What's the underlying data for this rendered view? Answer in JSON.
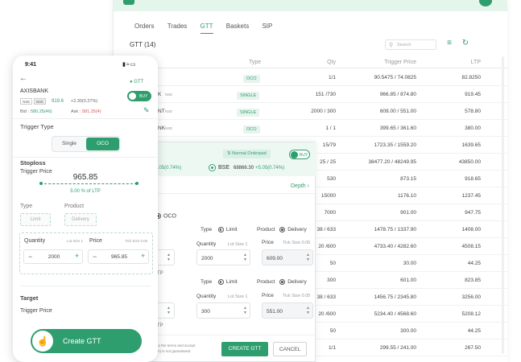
{
  "colors": {
    "accent": "#2f9e6e",
    "positive": "#2f9e6e",
    "negative": "#d9534f"
  },
  "desktop": {
    "tabs": [
      {
        "label": "Orders"
      },
      {
        "label": "Trades"
      },
      {
        "label": "GTT"
      },
      {
        "label": "Baskets"
      },
      {
        "label": "SIP"
      }
    ],
    "gtt_count_label": "GTT (14)",
    "search_placeholder": "Search",
    "columns": {
      "type": "Type",
      "qty": "Qty",
      "trigger_price": "Trigger Price",
      "ltp": "LTP"
    },
    "rows": [
      {
        "name": "",
        "exch": "",
        "type": "OCO",
        "qty": "1/1",
        "trigger": "90.5475 / 74.0825",
        "ltp": "82.8250"
      },
      {
        "name": "K",
        "exch": "NSE",
        "type": "SINGLE",
        "qty": "151 /730",
        "trigger": "966.85 / 874.80",
        "ltp": "919.45"
      },
      {
        "name": "NT",
        "exch": "NSE",
        "type": "SINGLE",
        "qty": "2000 / 300",
        "trigger": "609.00 / 551.00",
        "ltp": "578.80"
      },
      {
        "name": "NK",
        "exch": "NSE",
        "type": "OCO",
        "qty": "1 / 1",
        "trigger": "399.65 / 361.60",
        "ltp": "380.00"
      },
      {
        "name": "",
        "exch": "",
        "type": "",
        "qty": "15/79",
        "trigger": "1723.35 / 1559.20",
        "ltp": "1639.65"
      },
      {
        "name": "",
        "exch": "",
        "type": "",
        "qty": "25 / 25",
        "trigger": "38477.20 / 48249.95",
        "ltp": "43850.00"
      },
      {
        "name": "",
        "exch": "",
        "type": "",
        "qty": "530",
        "trigger": "873.15",
        "ltp": "918.65"
      },
      {
        "name": "",
        "exch": "",
        "type": "",
        "qty": "15000",
        "trigger": "1176.10",
        "ltp": "1237.45"
      },
      {
        "name": "",
        "exch": "",
        "type": "",
        "qty": "7000",
        "trigger": "901.00",
        "ltp": "947.75"
      },
      {
        "name": "",
        "exch": "",
        "type": "",
        "qty": "38 / 633",
        "trigger": "1478.75 / 1337.90",
        "ltp": "1408.00"
      },
      {
        "name": "",
        "exch": "",
        "type": "",
        "qty": "20 /600",
        "trigger": "4733.40 / 4282.60",
        "ltp": "4508.15"
      },
      {
        "name": "",
        "exch": "",
        "type": "",
        "qty": "50",
        "trigger": "30.00",
        "ltp": "44.25"
      },
      {
        "name": "",
        "exch": "",
        "type": "",
        "qty": "300",
        "trigger": "601.00",
        "ltp": "823.85"
      },
      {
        "name": "",
        "exch": "",
        "type": "",
        "qty": "38 / 633",
        "trigger": "1456.75 / 2345.80",
        "ltp": "3256.00"
      },
      {
        "name": "",
        "exch": "",
        "type": "",
        "qty": "20 /600",
        "trigger": "5234.40 / 4568.60",
        "ltp": "5208.12"
      },
      {
        "name": "",
        "exch": "",
        "type": "",
        "qty": "50",
        "trigger": "300.00",
        "ltp": "44.25"
      },
      {
        "name": "",
        "exch": "",
        "type": "",
        "qty": "1/1",
        "trigger": "299.55 / 241.00",
        "ltp": "267.50"
      }
    ]
  },
  "popover": {
    "order_tag": "Normal Orderpad",
    "buy_label": "BUY",
    "price_frag": "30",
    "change_left": "+5.05(0.74%)",
    "exchange_bse": "BSE",
    "bse_price": "68866.30",
    "bse_change": "+5.05(0.74%)",
    "depth_label": "Depth",
    "oco_label": "OCO",
    "type_label": "Type",
    "limit_label": "Limit",
    "product_label": "Product",
    "delivery_label": "Delivery",
    "quantity_label": "Quantity",
    "lot_size_label": "Lot Size 1",
    "price_label": "Price",
    "tick_size_label": "Tick Size 0.05",
    "qty_1": "2000",
    "price_1": "609.00",
    "qty_2": "300",
    "price_2": "551.00",
    "frag_tp1": "TP",
    "frag_tp2": "TP",
    "disclaimer_1": "ee to the terms and accept",
    "disclaimer_2": "ction) is not guaranteed.",
    "create_label": "CREATE GTT",
    "cancel_label": "CANCEL"
  },
  "phone": {
    "time": "9:41",
    "gtt_badge": "GTT",
    "symbol": "AXISBANK",
    "exch_nse": "NSE",
    "exch_bse": "BSE",
    "ltp": "919.6",
    "change": "+2.30(0.27%)",
    "bid_label": "Bid :",
    "bid_value": "580.25(46)",
    "ask_label": "Ask :",
    "ask_value": "581.25(4)",
    "buy_toggle": "BUY",
    "trigger_type_label": "Trigger Type",
    "single_label": "Single",
    "oco_label": "OCO",
    "stoploss_label": "Stoploss",
    "trigger_price_label": "Trigger Price",
    "trigger_price_value": "965.85",
    "ltp_pct": "5.00 % of LTP",
    "type_label": "Type",
    "product_label": "Product",
    "limit_label": "Limit",
    "delivery_label": "Delivery",
    "quantity_label": "Quantity",
    "lot_size": "Lot Size 1",
    "price_label": "Price",
    "tick_size": "Tick Size 0.05",
    "qty_value": "2000",
    "price_value": "965.85",
    "target_label": "Target",
    "target_trigger_label": "Trigger Price",
    "create_label": "Create GTT"
  }
}
